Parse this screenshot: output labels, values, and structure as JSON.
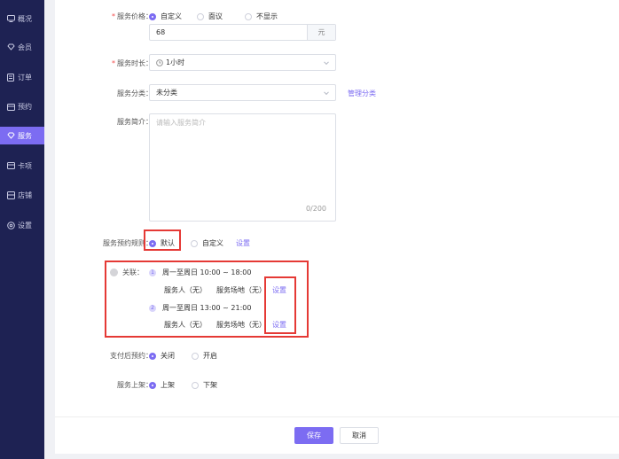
{
  "sidebar": {
    "items": [
      {
        "label": "概况",
        "icon": "monitor-icon"
      },
      {
        "label": "会员",
        "icon": "diamond-icon"
      },
      {
        "label": "订单",
        "icon": "list-icon"
      },
      {
        "label": "预约",
        "icon": "calendar-icon"
      },
      {
        "label": "服务",
        "icon": "service-icon",
        "active": true
      },
      {
        "label": "卡项",
        "icon": "card-icon"
      },
      {
        "label": "店铺",
        "icon": "store-icon"
      },
      {
        "label": "设置",
        "icon": "gear-icon"
      }
    ]
  },
  "form": {
    "price": {
      "label": "服务价格：",
      "options": [
        "自定义",
        "面议",
        "不显示"
      ],
      "selected": "自定义",
      "value": "68",
      "unit": "元"
    },
    "duration": {
      "label": "服务时长：",
      "value": "1小时"
    },
    "category": {
      "label": "服务分类：",
      "value": "未分类",
      "manage_link": "管理分类"
    },
    "intro": {
      "label": "服务简介：",
      "placeholder": "请输入服务简介",
      "counter": "0/200"
    },
    "booking_rule": {
      "label": "服务预约规则：",
      "options": [
        "默认",
        "自定义"
      ],
      "selected": "默认",
      "set_link": "设置"
    },
    "association": {
      "label": "关联：",
      "rules": [
        {
          "index": "1",
          "time": "周一至周日 10:00 ~ 18:00",
          "staff": "服务人（无）",
          "site": "服务场地（无）",
          "set_link": "设置"
        },
        {
          "index": "2",
          "time": "周一至周日 13:00 ~ 21:00",
          "staff": "服务人（无）",
          "site": "服务场地（无）",
          "set_link": "设置"
        }
      ]
    },
    "prepay": {
      "label": "支付后预约：",
      "options": [
        "关闭",
        "开启"
      ],
      "selected": "关闭"
    },
    "listing": {
      "label": "服务上架：",
      "options": [
        "上架",
        "下架"
      ],
      "selected": "上架"
    }
  },
  "footer": {
    "save_label": "保存",
    "cancel_label": "取消"
  },
  "colors": {
    "accent": "#7c6cf2",
    "sidebar_bg": "#1e2253",
    "highlight_red": "#e53935"
  }
}
